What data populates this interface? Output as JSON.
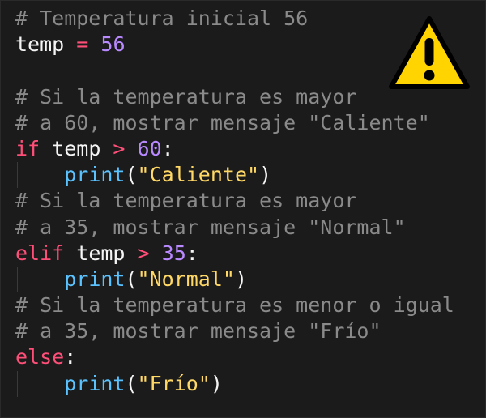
{
  "editor": {
    "lines": [
      {
        "indent": false,
        "tokens": [
          {
            "t": "comment",
            "v": "# Temperatura inicial 56"
          }
        ]
      },
      {
        "indent": false,
        "tokens": [
          {
            "t": "text",
            "v": "temp "
          },
          {
            "t": "op",
            "v": "="
          },
          {
            "t": "text",
            "v": " "
          },
          {
            "t": "num",
            "v": "56"
          }
        ]
      },
      {
        "indent": false,
        "tokens": []
      },
      {
        "indent": false,
        "tokens": [
          {
            "t": "comment",
            "v": "# Si la temperatura es mayor"
          }
        ]
      },
      {
        "indent": false,
        "tokens": [
          {
            "t": "comment",
            "v": "# a 60, mostrar mensaje \"Caliente\""
          }
        ]
      },
      {
        "indent": false,
        "tokens": [
          {
            "t": "kw",
            "v": "if"
          },
          {
            "t": "text",
            "v": " temp "
          },
          {
            "t": "op",
            "v": ">"
          },
          {
            "t": "text",
            "v": " "
          },
          {
            "t": "num",
            "v": "60"
          },
          {
            "t": "punc",
            "v": ":"
          }
        ]
      },
      {
        "indent": true,
        "tokens": [
          {
            "t": "text",
            "v": "    "
          },
          {
            "t": "builtin",
            "v": "print"
          },
          {
            "t": "punc",
            "v": "("
          },
          {
            "t": "string",
            "v": "\"Caliente\""
          },
          {
            "t": "punc",
            "v": ")"
          }
        ]
      },
      {
        "indent": false,
        "tokens": [
          {
            "t": "comment",
            "v": "# Si la temperatura es mayor"
          }
        ]
      },
      {
        "indent": false,
        "tokens": [
          {
            "t": "comment",
            "v": "# a 35, mostrar mensaje \"Normal\""
          }
        ]
      },
      {
        "indent": false,
        "tokens": [
          {
            "t": "kw",
            "v": "elif"
          },
          {
            "t": "text",
            "v": " temp "
          },
          {
            "t": "op",
            "v": ">"
          },
          {
            "t": "text",
            "v": " "
          },
          {
            "t": "num",
            "v": "35"
          },
          {
            "t": "punc",
            "v": ":"
          }
        ]
      },
      {
        "indent": true,
        "tokens": [
          {
            "t": "text",
            "v": "    "
          },
          {
            "t": "builtin",
            "v": "print"
          },
          {
            "t": "punc",
            "v": "("
          },
          {
            "t": "string",
            "v": "\"Normal\""
          },
          {
            "t": "punc",
            "v": ")"
          }
        ]
      },
      {
        "indent": false,
        "tokens": [
          {
            "t": "comment",
            "v": "# Si la temperatura es menor o igual"
          }
        ]
      },
      {
        "indent": false,
        "tokens": [
          {
            "t": "comment",
            "v": "# a 35, mostrar mensaje \"Frío\""
          }
        ]
      },
      {
        "indent": false,
        "tokens": [
          {
            "t": "kw",
            "v": "else"
          },
          {
            "t": "punc",
            "v": ":"
          }
        ]
      },
      {
        "indent": true,
        "tokens": [
          {
            "t": "text",
            "v": "    "
          },
          {
            "t": "builtin",
            "v": "print"
          },
          {
            "t": "punc",
            "v": "("
          },
          {
            "t": "string",
            "v": "\"Frío\""
          },
          {
            "t": "punc",
            "v": ")"
          }
        ]
      }
    ]
  },
  "warning_icon": {
    "icon": "warning-triangle-icon",
    "fill": "#ffd400",
    "stroke": "#000000",
    "glyph": "!"
  },
  "colors": {
    "background": "#1b1b1b",
    "comment": "#8a8a8a",
    "keyword": "#ff4f79",
    "number": "#b889ff",
    "builtin": "#59c2ff",
    "string": "#ffd866",
    "text": "#f5f5f5"
  }
}
